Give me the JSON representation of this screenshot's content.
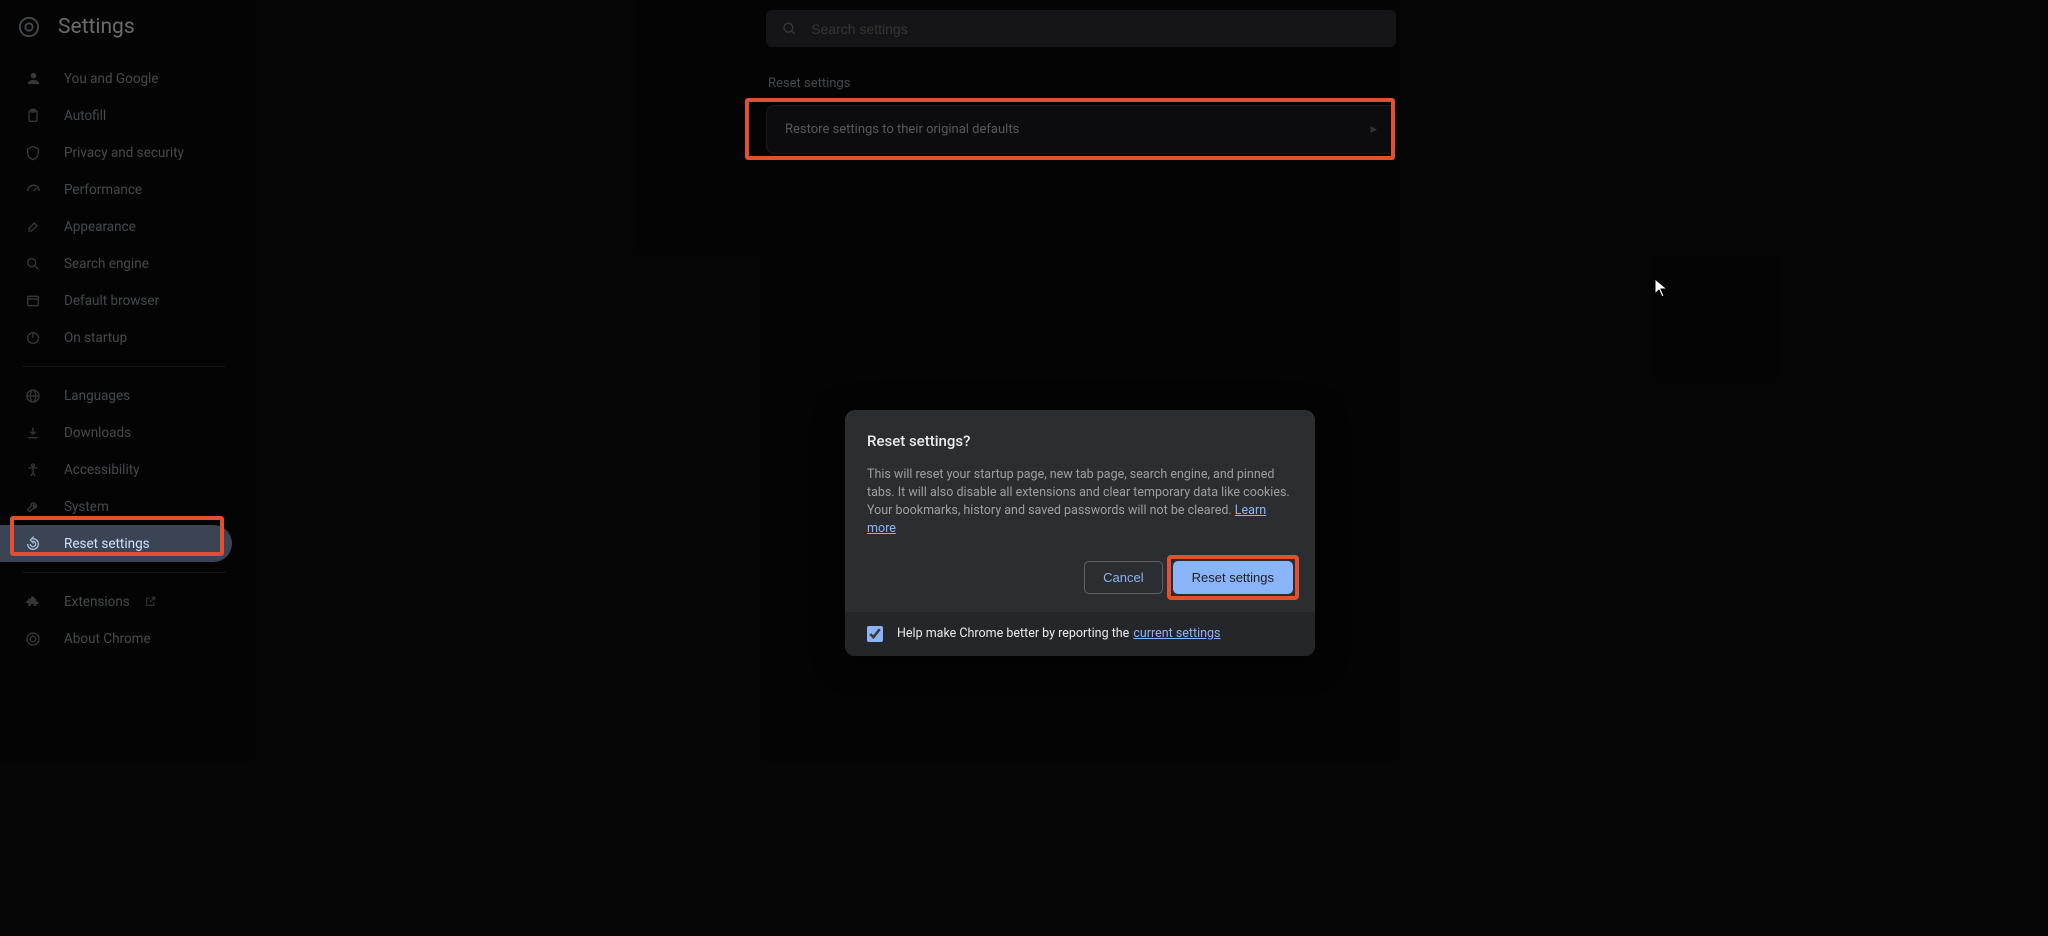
{
  "header": {
    "title": "Settings",
    "search_placeholder": "Search settings"
  },
  "sidebar": {
    "group1": [
      {
        "id": "you-google",
        "label": "You and Google",
        "icon": "person"
      },
      {
        "id": "autofill",
        "label": "Autofill",
        "icon": "clipboard"
      },
      {
        "id": "privacy",
        "label": "Privacy and security",
        "icon": "shield"
      },
      {
        "id": "performance",
        "label": "Performance",
        "icon": "speed"
      },
      {
        "id": "appearance",
        "label": "Appearance",
        "icon": "brush"
      },
      {
        "id": "search-engine",
        "label": "Search engine",
        "icon": "search"
      },
      {
        "id": "default-browser",
        "label": "Default browser",
        "icon": "browser"
      },
      {
        "id": "on-startup",
        "label": "On startup",
        "icon": "power"
      }
    ],
    "group2": [
      {
        "id": "languages",
        "label": "Languages",
        "icon": "globe"
      },
      {
        "id": "downloads",
        "label": "Downloads",
        "icon": "download"
      },
      {
        "id": "accessibility",
        "label": "Accessibility",
        "icon": "accessibility"
      },
      {
        "id": "system",
        "label": "System",
        "icon": "wrench"
      },
      {
        "id": "reset-settings",
        "label": "Reset settings",
        "icon": "restore",
        "selected": true
      }
    ],
    "group3": [
      {
        "id": "extensions",
        "label": "Extensions",
        "icon": "extension",
        "external": true
      },
      {
        "id": "about",
        "label": "About Chrome",
        "icon": "chrome"
      }
    ]
  },
  "main": {
    "section_title": "Reset settings",
    "card_label": "Restore settings to their original defaults"
  },
  "dialog": {
    "title": "Reset settings?",
    "text": "This will reset your startup page, new tab page, search engine, and pinned tabs. It will also disable all extensions and clear temporary data like cookies. Your bookmarks, history and saved passwords will not be cleared.",
    "learn_more": "Learn more",
    "cancel": "Cancel",
    "confirm": "Reset settings",
    "footer_text": "Help make Chrome better by reporting the",
    "footer_link": "current settings",
    "footer_checked": true
  },
  "highlight_color": "#e15032"
}
